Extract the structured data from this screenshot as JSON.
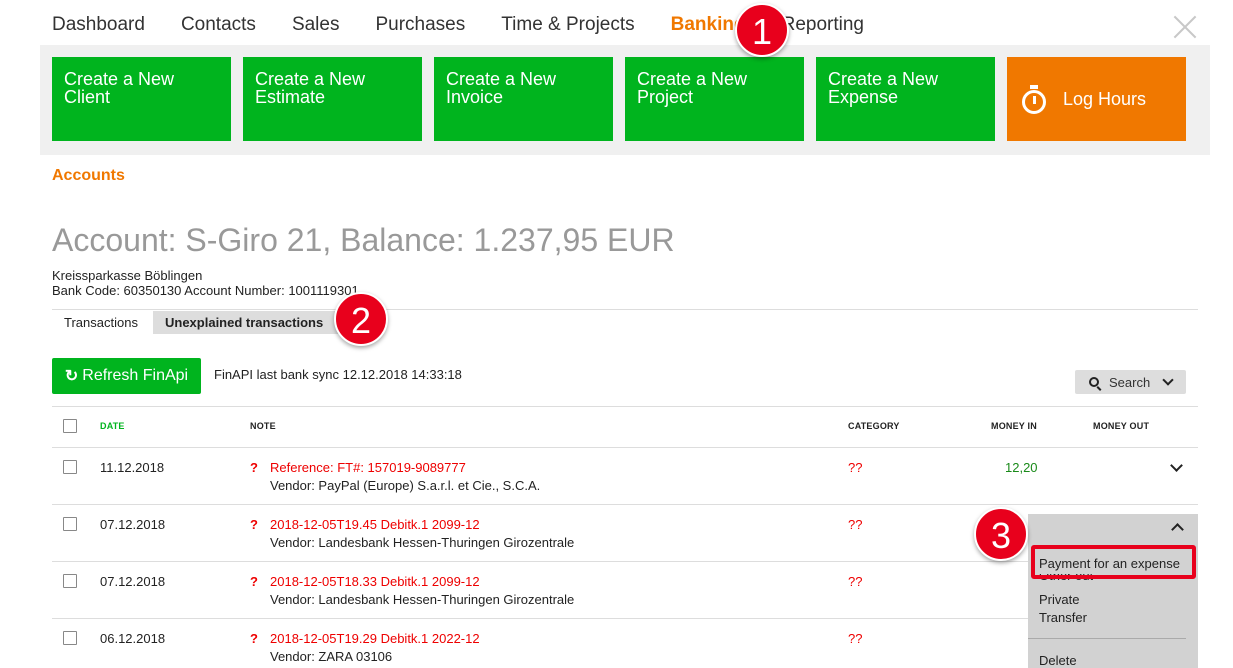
{
  "nav": {
    "items": [
      "Dashboard",
      "Contacts",
      "Sales",
      "Purchases",
      "Time & Projects",
      "Banking",
      "Reporting"
    ],
    "active": "Banking"
  },
  "actions": {
    "new_client": "Create a New Client",
    "new_estimate": "Create a New Estimate",
    "new_invoice": "Create a New Invoice",
    "new_project": "Create a New Project",
    "new_expense": "Create a New Expense",
    "log_hours": "Log Hours"
  },
  "breadcrumb": "Accounts",
  "account": {
    "title": "Account: S-Giro 21, Balance: 1.237,95 EUR",
    "bank_name": "Kreissparkasse Böblingen",
    "bank_details": "Bank Code: 60350130 Account Number: 1001119301"
  },
  "tabs": {
    "transactions": "Transactions",
    "unexplained": "Unexplained transactions"
  },
  "toolbar": {
    "refresh_label": "Refresh FinApi",
    "sync_text": "FinAPI last bank sync 12.12.2018 14:33:18",
    "search_label": "Search"
  },
  "table": {
    "headers": {
      "date": "DATE",
      "note": "NOTE",
      "category": "CATEGORY",
      "money_in": "MONEY IN",
      "money_out": "MONEY OUT"
    },
    "rows": [
      {
        "date": "11.12.2018",
        "note": "Reference: FT#: 157019-9089777",
        "vendor": "Vendor: PayPal (Europe) S.a.r.l. et Cie., S.C.A.",
        "category": "??",
        "money_in": "12,20"
      },
      {
        "date": "07.12.2018",
        "note": "2018-12-05T19.45 Debitk.1 2099-12",
        "vendor": "Vendor: Landesbank Hessen-Thuringen Girozentrale",
        "category": "??"
      },
      {
        "date": "07.12.2018",
        "note": "2018-12-05T18.33 Debitk.1 2099-12",
        "vendor": "Vendor: Landesbank Hessen-Thuringen Girozentrale",
        "category": "??"
      },
      {
        "date": "06.12.2018",
        "note": "2018-12-05T19.29 Debitk.1 2022-12",
        "vendor": "Vendor: ZARA 03106",
        "category": "??"
      }
    ],
    "flag": "?"
  },
  "dropdown": {
    "items": [
      "Payment for an expense",
      "Other out",
      "Private",
      "Transfer",
      "Delete"
    ]
  },
  "callouts": [
    "1",
    "2",
    "3"
  ],
  "colors": {
    "green": "#00b41e",
    "orange": "#f07800",
    "red": "#e8001c"
  }
}
